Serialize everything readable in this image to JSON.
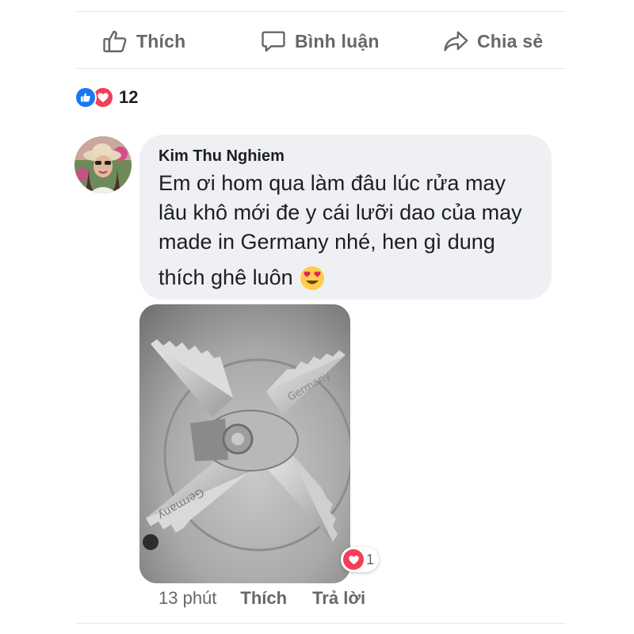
{
  "actions": {
    "like_label": "Thích",
    "comment_label": "Bình luận",
    "share_label": "Chia sẻ"
  },
  "reactions": {
    "types": [
      "like-icon",
      "love-icon"
    ],
    "count": "12"
  },
  "comment": {
    "author": "Kim Thu Nghiem",
    "lines": [
      "Em ơi hom qua làm đâu lúc rửa may",
      "lâu khô mới đe y cái lưỡi dao của may",
      "made in Germany nhé, hen gì dung",
      "thích ghê luôn"
    ],
    "emoji": "heart-eyes-icon",
    "photo_engraving": "Germany",
    "reaction": {
      "type": "love-icon",
      "count": "1"
    },
    "time": "13 phút",
    "like_label": "Thích",
    "reply_label": "Trả lời"
  },
  "colors": {
    "secondary_text": "#65676b",
    "bubble": "#eef0f4",
    "like_blue": "#1877f2",
    "love_red": "#f33e58"
  }
}
